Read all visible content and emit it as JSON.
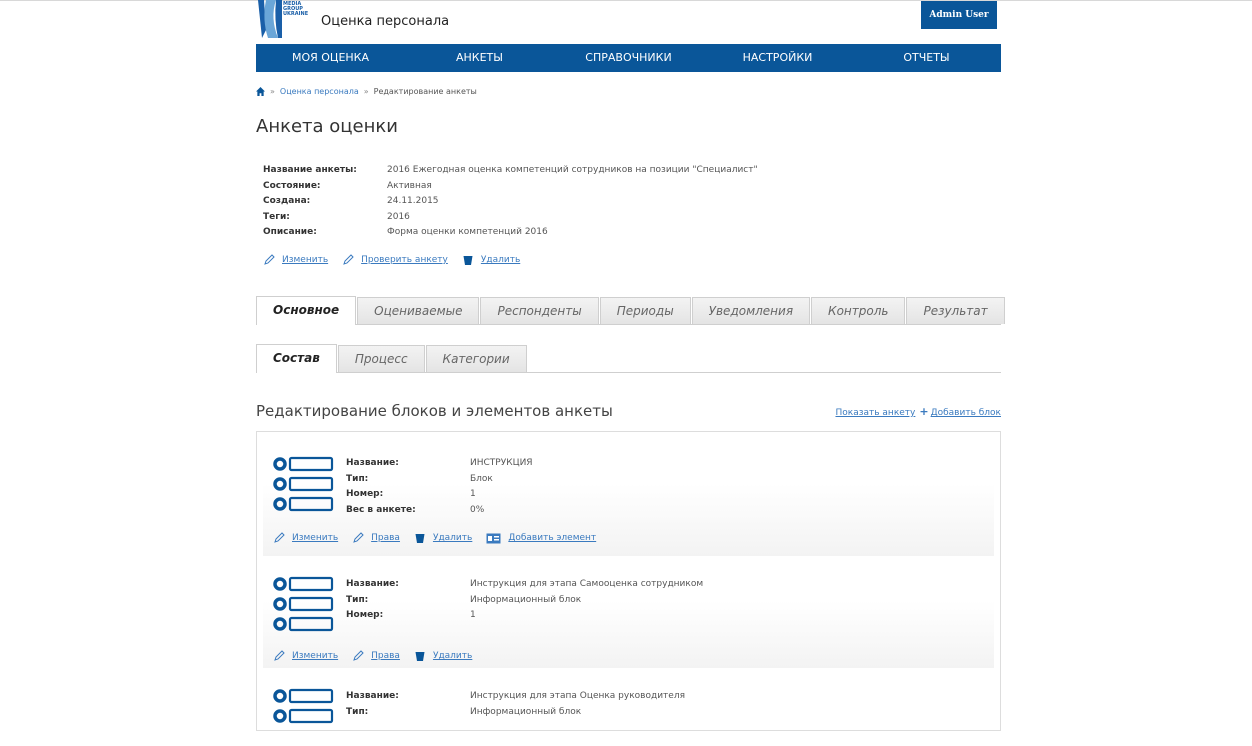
{
  "header": {
    "logo_lines": [
      "MEDIA",
      "GROUP",
      "UKRAINE"
    ],
    "app_title": "Оценка персонала",
    "user": "Admin User"
  },
  "nav": [
    "МОЯ ОЦЕНКА",
    "АНКЕТЫ",
    "СПРАВОЧНИКИ",
    "НАСТРОЙКИ",
    "ОТЧЕТЫ"
  ],
  "breadcrumb": {
    "link": "Оценка персонала",
    "current": "Редактирование анкеты",
    "sep": "»"
  },
  "page_title": "Анкета оценки",
  "form": {
    "name_label": "Название анкеты:",
    "name_value": "2016 Ежегодная оценка компетенций сотрудников на позиции \"Специалист\"",
    "state_label": "Состояние:",
    "state_value": "Активная",
    "created_label": "Создана:",
    "created_value": "24.11.2015",
    "tags_label": "Теги:",
    "tags_value": "2016",
    "desc_label": "Описание:",
    "desc_value": "Форма оценки компетенций 2016",
    "edit": "Изменить",
    "check": "Проверить анкету",
    "delete": "Удалить"
  },
  "tabs_main": [
    "Основное",
    "Оцениваемые",
    "Респонденты",
    "Периоды",
    "Уведомления",
    "Контроль",
    "Результат"
  ],
  "tabs_sub": [
    "Состав",
    "Процесс",
    "Категории"
  ],
  "section": {
    "title": "Редактирование блоков и элементов анкеты",
    "show": "Показать анкету",
    "add_block": "Добавить блок",
    "plus": "+"
  },
  "blocks": [
    {
      "name_label": "Название:",
      "name": "ИНСТРУКЦИЯ",
      "type_label": "Тип:",
      "type": "Блок",
      "num_label": "Номер:",
      "num": "1",
      "weight_label": "Вес в анкете:",
      "weight": "0%",
      "edit": "Изменить",
      "rights": "Права",
      "delete": "Удалить",
      "add_element": "Добавить элемент"
    },
    {
      "name_label": "Название:",
      "name": "Инструкция для этапа Самооценка сотрудником",
      "type_label": "Тип:",
      "type": "Информационный блок",
      "num_label": "Номер:",
      "num": "1",
      "edit": "Изменить",
      "rights": "Права",
      "delete": "Удалить"
    },
    {
      "name_label": "Название:",
      "name": "Инструкция для этапа Оценка руководителя",
      "type_label": "Тип:",
      "type": "Информационный блок"
    }
  ],
  "colors": {
    "brand": "#0a5699",
    "link": "#3a7abf"
  }
}
